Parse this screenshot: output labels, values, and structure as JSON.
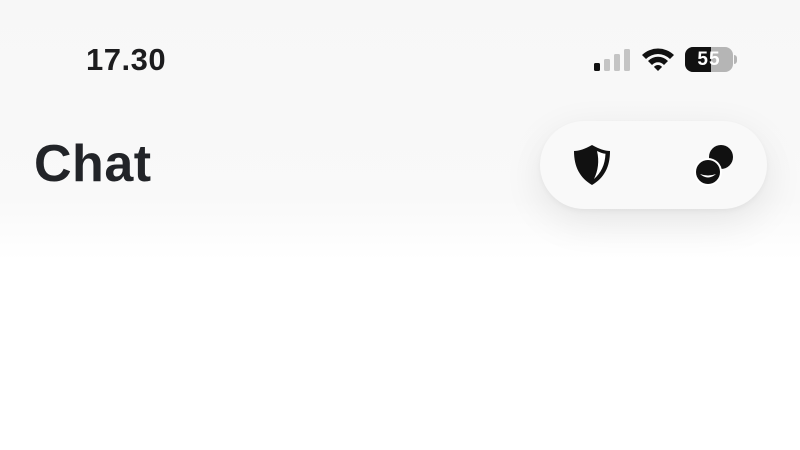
{
  "status_bar": {
    "time": "17.30",
    "signal_bars_active": 1,
    "signal_bars_total": 4,
    "wifi_icon": "wifi-icon",
    "battery_percent": 55,
    "battery_label": "55"
  },
  "header": {
    "title": "Chat",
    "actions": [
      {
        "name": "privacy-shield-button",
        "icon": "shield-icon"
      },
      {
        "name": "new-group-chat-button",
        "icon": "group-chat-icon"
      }
    ]
  },
  "colors": {
    "title": "#222428",
    "icon": "#111111",
    "pill_background": "#f9f9f9",
    "battery_empty": "#b5b5b5"
  }
}
